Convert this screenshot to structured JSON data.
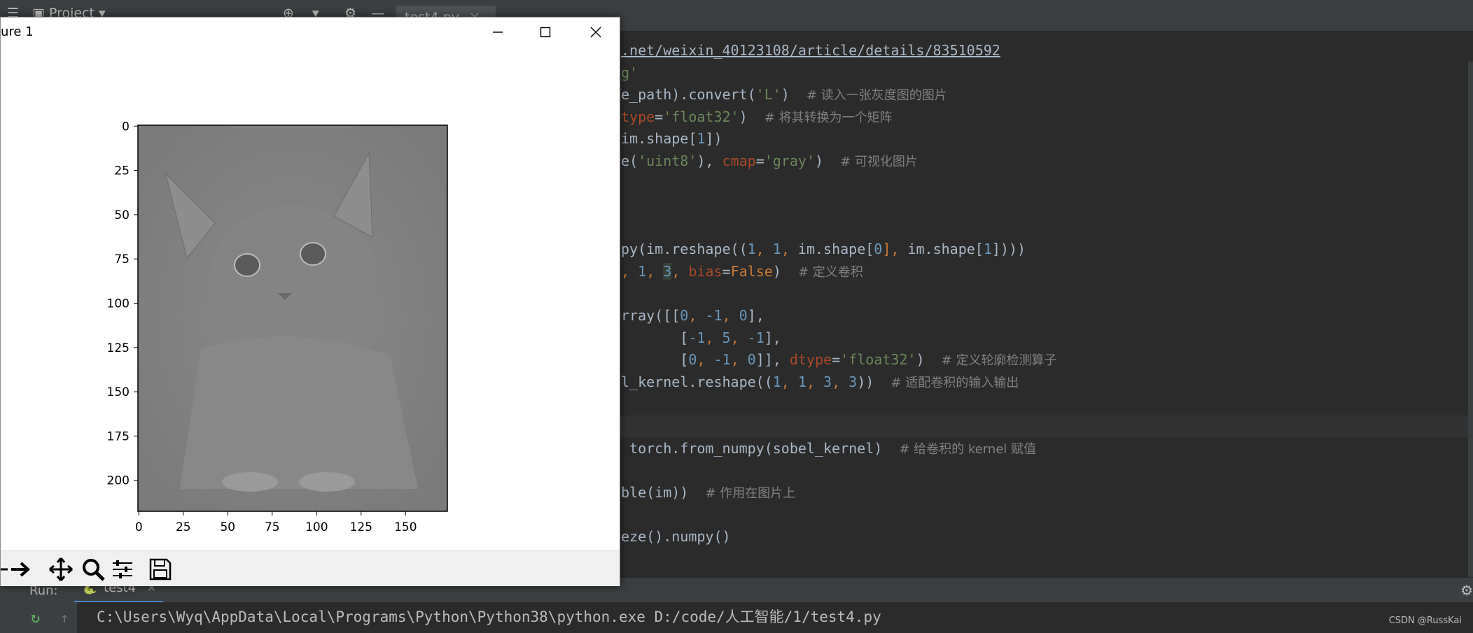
{
  "ide": {
    "topbar": {
      "project_label": "Project",
      "tab": "test4.py"
    },
    "code_lines": [
      {
        "parts": [
          {
            "t": ".net/weixin_40123108/article/details/83510592",
            "c": "url"
          }
        ]
      },
      {
        "parts": [
          {
            "t": "g'",
            "c": "str"
          }
        ]
      },
      {
        "parts": [
          {
            "t": "e_path).convert(",
            "c": ""
          },
          {
            "t": "'L'",
            "c": "str"
          },
          {
            "t": ")  ",
            "c": ""
          },
          {
            "t": "# 读入一张灰度图的图片",
            "c": "cmt"
          }
        ]
      },
      {
        "parts": [
          {
            "t": "type",
            "c": "param"
          },
          {
            "t": "=",
            "c": ""
          },
          {
            "t": "'float32'",
            "c": "str"
          },
          {
            "t": ")  ",
            "c": ""
          },
          {
            "t": "# 将其转换为一个矩阵",
            "c": "cmt"
          }
        ]
      },
      {
        "parts": [
          {
            "t": "im.shape[",
            "c": ""
          },
          {
            "t": "1",
            "c": "num"
          },
          {
            "t": "])",
            "c": ""
          }
        ]
      },
      {
        "parts": [
          {
            "t": "e(",
            "c": ""
          },
          {
            "t": "'uint8'",
            "c": "str"
          },
          {
            "t": "), ",
            "c": ""
          },
          {
            "t": "cmap",
            "c": "param"
          },
          {
            "t": "=",
            "c": ""
          },
          {
            "t": "'gray'",
            "c": "str"
          },
          {
            "t": ")  ",
            "c": ""
          },
          {
            "t": "# 可视化图片",
            "c": "cmt"
          }
        ]
      },
      {
        "parts": []
      },
      {
        "parts": []
      },
      {
        "parts": []
      },
      {
        "parts": [
          {
            "t": "py(im.reshape((",
            "c": ""
          },
          {
            "t": "1",
            "c": "num"
          },
          {
            "t": ", ",
            "c": "kw"
          },
          {
            "t": "1",
            "c": "num"
          },
          {
            "t": ", ",
            "c": "kw"
          },
          {
            "t": "im.shape[",
            "c": ""
          },
          {
            "t": "0",
            "c": "num"
          },
          {
            "t": "], ",
            "c": "kw"
          },
          {
            "t": "im.shape[",
            "c": ""
          },
          {
            "t": "1",
            "c": "num"
          },
          {
            "t": "])))",
            "c": ""
          }
        ]
      },
      {
        "parts": [
          {
            "t": ", ",
            "c": "kw"
          },
          {
            "t": "1",
            "c": "num"
          },
          {
            "t": ", ",
            "c": "kw"
          },
          {
            "t": "3",
            "c": "hl num"
          },
          {
            "t": ", ",
            "c": "kw"
          },
          {
            "t": "bias",
            "c": "param"
          },
          {
            "t": "=",
            "c": ""
          },
          {
            "t": "False",
            "c": "kw"
          },
          {
            "t": ")  ",
            "c": ""
          },
          {
            "t": "# 定义卷积",
            "c": "cmt"
          }
        ]
      },
      {
        "parts": []
      },
      {
        "parts": [
          {
            "t": "rray([[",
            "c": ""
          },
          {
            "t": "0",
            "c": "num"
          },
          {
            "t": ", ",
            "c": "kw"
          },
          {
            "t": "-1",
            "c": "num"
          },
          {
            "t": ", ",
            "c": "kw"
          },
          {
            "t": "0",
            "c": "num"
          },
          {
            "t": "],",
            "c": ""
          }
        ]
      },
      {
        "parts": [
          {
            "t": "       [",
            "c": ""
          },
          {
            "t": "-1",
            "c": "num"
          },
          {
            "t": ", ",
            "c": "kw"
          },
          {
            "t": "5",
            "c": "num"
          },
          {
            "t": ", ",
            "c": "kw"
          },
          {
            "t": "-1",
            "c": "num"
          },
          {
            "t": "],",
            "c": ""
          }
        ]
      },
      {
        "parts": [
          {
            "t": "       [",
            "c": ""
          },
          {
            "t": "0",
            "c": "num"
          },
          {
            "t": ", ",
            "c": "kw"
          },
          {
            "t": "-1",
            "c": "num"
          },
          {
            "t": ", ",
            "c": "kw"
          },
          {
            "t": "0",
            "c": "num"
          },
          {
            "t": "]], ",
            "c": ""
          },
          {
            "t": "dtype",
            "c": "param"
          },
          {
            "t": "=",
            "c": ""
          },
          {
            "t": "'float32'",
            "c": "str"
          },
          {
            "t": ")  ",
            "c": ""
          },
          {
            "t": "# 定义轮廓检测算子",
            "c": "cmt"
          }
        ]
      },
      {
        "parts": [
          {
            "t": "l_kernel.reshape((",
            "c": ""
          },
          {
            "t": "1",
            "c": "num"
          },
          {
            "t": ", ",
            "c": "kw"
          },
          {
            "t": "1",
            "c": "num"
          },
          {
            "t": ", ",
            "c": "kw"
          },
          {
            "t": "3",
            "c": "num"
          },
          {
            "t": ", ",
            "c": "kw"
          },
          {
            "t": "3",
            "c": "num"
          },
          {
            "t": "))  ",
            "c": ""
          },
          {
            "t": "# 适配卷积的输入输出",
            "c": "cmt"
          }
        ]
      },
      {
        "parts": []
      },
      {
        "parts": []
      },
      {
        "parts": [
          {
            "t": " torch.from_numpy(sobel_kernel)  ",
            "c": ""
          },
          {
            "t": "# 给卷积的 kernel 赋值",
            "c": "cmt"
          }
        ]
      },
      {
        "parts": []
      },
      {
        "parts": [
          {
            "t": "ble(im))  ",
            "c": ""
          },
          {
            "t": "# 作用在图片上",
            "c": "cmt"
          }
        ]
      },
      {
        "parts": []
      },
      {
        "parts": [
          {
            "t": "eze().numpy()",
            "c": ""
          }
        ]
      }
    ],
    "run": {
      "label": "Run:",
      "tab": "test4",
      "command": "C:\\Users\\Wyq\\AppData\\Local\\Programs\\Python\\Python38\\python.exe D:/code/人工智能/1/test4.py"
    },
    "watermark": "CSDN @RussKai"
  },
  "figure": {
    "title": "ure 1",
    "image_description_icon": "kitten-grayscale-image",
    "x_ticks": [
      "0",
      "25",
      "50",
      "75",
      "100",
      "125",
      "150"
    ],
    "y_ticks": [
      "0",
      "25",
      "50",
      "75",
      "100",
      "125",
      "150",
      "175",
      "200"
    ],
    "toolbar_icons": [
      "forward-arrow-icon",
      "pan-icon",
      "zoom-icon",
      "configure-subplots-icon",
      "save-icon"
    ]
  }
}
